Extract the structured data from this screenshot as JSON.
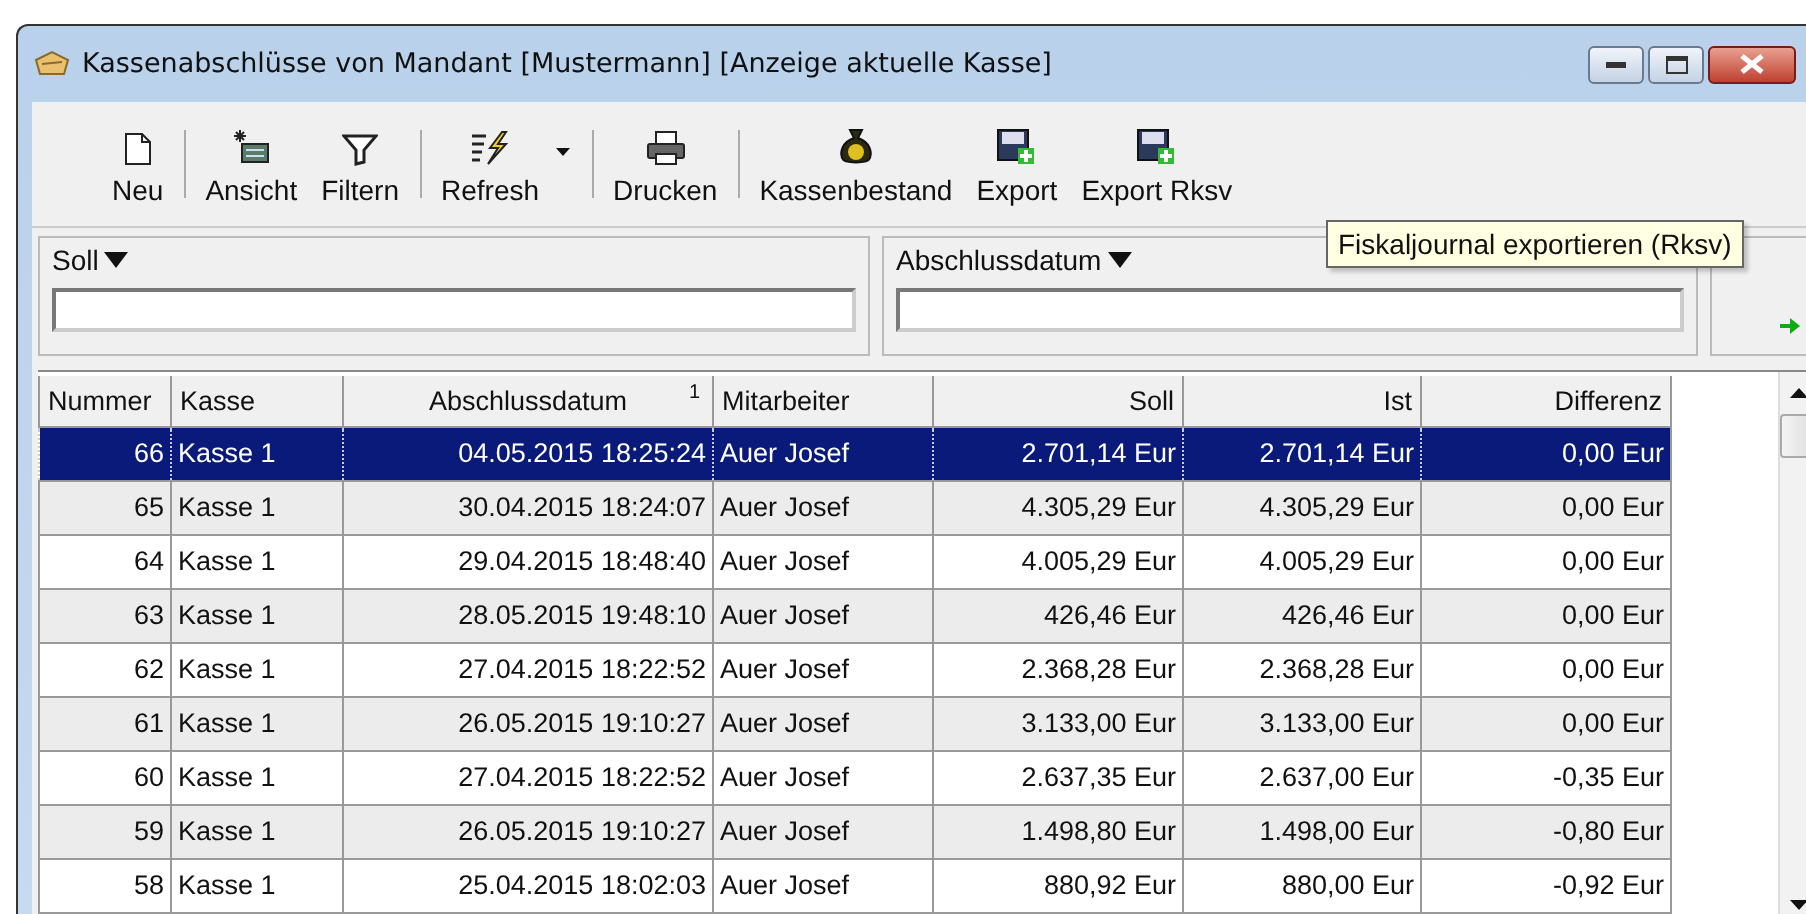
{
  "window": {
    "title": "Kassenabschlüsse von Mandant [Mustermann] [Anzeige aktuelle Kasse]"
  },
  "toolbar": [
    {
      "kind": "button",
      "label": "Neu"
    },
    {
      "kind": "separator"
    },
    {
      "kind": "button",
      "label": "Ansicht"
    },
    {
      "kind": "button",
      "label": "Filtern"
    },
    {
      "kind": "separator"
    },
    {
      "kind": "dropdown",
      "label": "Refresh"
    },
    {
      "kind": "separator"
    },
    {
      "kind": "button",
      "label": "Drucken"
    },
    {
      "kind": "separator"
    },
    {
      "kind": "button",
      "label": "Kassenbestand"
    },
    {
      "kind": "button",
      "label": "Export"
    },
    {
      "kind": "button",
      "label": "Export Rksv"
    }
  ],
  "tooltip": "Fiskaljournal exportieren (Rksv)",
  "filters": [
    {
      "label": "Soll"
    },
    {
      "label": "Abschlussdatum"
    }
  ],
  "table": {
    "columns": [
      {
        "label": "Nummer"
      },
      {
        "label": "Kasse"
      },
      {
        "label": "Abschlussdatum",
        "sort": "1"
      },
      {
        "label": "Mitarbeiter"
      },
      {
        "label": "Soll"
      },
      {
        "label": "Ist"
      },
      {
        "label": "Differenz"
      }
    ],
    "rows": [
      {
        "selected": true,
        "cells": [
          "66",
          "Kasse 1",
          "04.05.2015 18:25:24",
          "Auer Josef",
          "2.701,14 Eur",
          "2.701,14 Eur",
          "0,00 Eur"
        ]
      },
      {
        "selected": false,
        "cells": [
          "65",
          "Kasse 1",
          "30.04.2015 18:24:07",
          "Auer Josef",
          "4.305,29 Eur",
          "4.305,29 Eur",
          "0,00 Eur"
        ]
      },
      {
        "selected": false,
        "cells": [
          "64",
          "Kasse 1",
          "29.04.2015 18:48:40",
          "Auer Josef",
          "4.005,29 Eur",
          "4.005,29 Eur",
          "0,00 Eur"
        ]
      },
      {
        "selected": false,
        "cells": [
          "63",
          "Kasse 1",
          "28.05.2015 19:48:10",
          "Auer Josef",
          "426,46 Eur",
          "426,46 Eur",
          "0,00 Eur"
        ]
      },
      {
        "selected": false,
        "cells": [
          "62",
          "Kasse 1",
          "27.04.2015 18:22:52",
          "Auer Josef",
          "2.368,28 Eur",
          "2.368,28 Eur",
          "0,00 Eur"
        ]
      },
      {
        "selected": false,
        "cells": [
          "61",
          "Kasse 1",
          "26.05.2015 19:10:27",
          "Auer Josef",
          "3.133,00 Eur",
          "3.133,00 Eur",
          "0,00 Eur"
        ]
      },
      {
        "selected": false,
        "cells": [
          "60",
          "Kasse 1",
          "27.04.2015 18:22:52",
          "Auer Josef",
          "2.637,35 Eur",
          "2.637,00 Eur",
          "-0,35 Eur"
        ]
      },
      {
        "selected": false,
        "cells": [
          "59",
          "Kasse 1",
          "26.05.2015 19:10:27",
          "Auer Josef",
          "1.498,80 Eur",
          "1.498,00 Eur",
          "-0,80 Eur"
        ]
      },
      {
        "selected": false,
        "cells": [
          "58",
          "Kasse 1",
          "25.04.2015 18:02:03",
          "Auer Josef",
          "880,92 Eur",
          "880,00 Eur",
          "-0,92 Eur"
        ]
      }
    ]
  }
}
